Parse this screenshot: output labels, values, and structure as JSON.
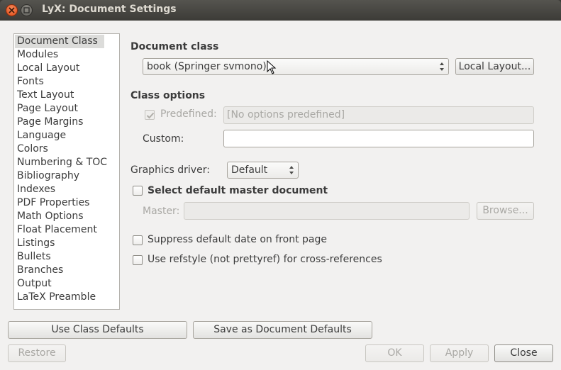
{
  "window": {
    "title": "LyX: Document Settings"
  },
  "nav": {
    "items": [
      "Document Class",
      "Modules",
      "Local Layout",
      "Fonts",
      "Text Layout",
      "Page Layout",
      "Page Margins",
      "Language",
      "Colors",
      "Numbering & TOC",
      "Bibliography",
      "Indexes",
      "PDF Properties",
      "Math Options",
      "Float Placement",
      "Listings",
      "Bullets",
      "Branches",
      "Output",
      "LaTeX Preamble"
    ],
    "selected": "Document Class"
  },
  "document_class": {
    "heading": "Document class",
    "selected_class": "book (Springer svmono)",
    "local_layout_button": "Local Layout..."
  },
  "class_options": {
    "heading": "Class options",
    "predefined_label": "Predefined:",
    "predefined_checked": true,
    "predefined_value": "[No options predefined]",
    "custom_label": "Custom:",
    "custom_value": ""
  },
  "graphics": {
    "label": "Graphics driver:",
    "value": "Default"
  },
  "master": {
    "checkbox_label": "Select default master document",
    "checked": false,
    "field_label": "Master:",
    "field_value": "",
    "browse_button": "Browse..."
  },
  "options": {
    "suppress_date_label": "Suppress default date on front page",
    "suppress_date_checked": false,
    "refstyle_label": "Use refstyle (not prettyref) for cross-references",
    "refstyle_checked": false
  },
  "buttons": {
    "use_class_defaults": "Use Class Defaults",
    "save_as_defaults": "Save as Document Defaults",
    "restore": "Restore",
    "ok": "OK",
    "apply": "Apply",
    "close": "Close"
  }
}
